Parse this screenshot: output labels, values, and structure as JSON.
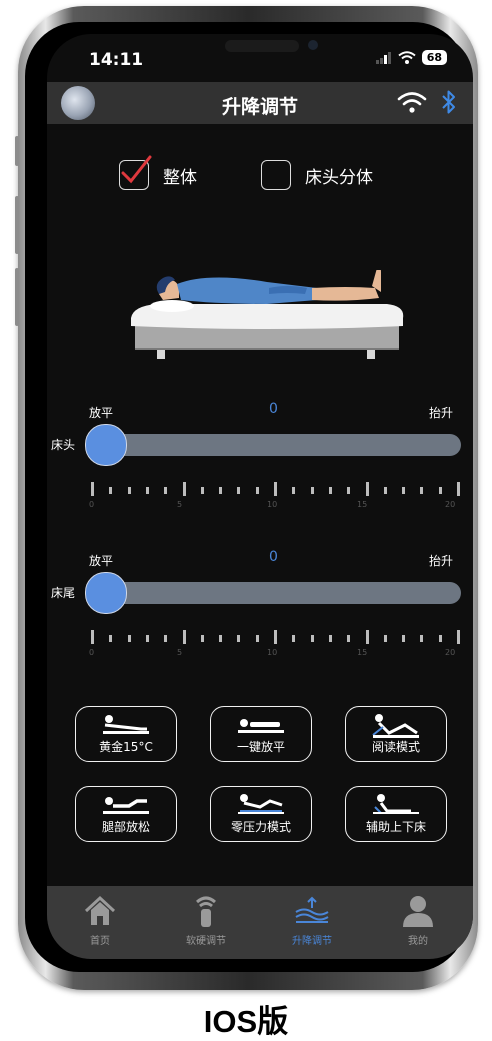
{
  "status_bar": {
    "time": "14:11",
    "battery": "68"
  },
  "header": {
    "title": "升降调节"
  },
  "mode": {
    "whole_label": "整体",
    "split_label": "床头分体",
    "whole_checked": true,
    "split_checked": false
  },
  "head_slider": {
    "left_label": "放平",
    "right_label": "抬升",
    "side_label": "床头",
    "value": "0",
    "tick_labels": [
      "0",
      "5",
      "10",
      "15",
      "20"
    ]
  },
  "foot_slider": {
    "left_label": "放平",
    "right_label": "抬升",
    "side_label": "床尾",
    "value": "0",
    "tick_labels": [
      "0",
      "5",
      "10",
      "15",
      "20"
    ]
  },
  "functions": [
    {
      "label": "黄金15°C",
      "icon": "golden-angle-icon"
    },
    {
      "label": "一键放平",
      "icon": "flat-icon"
    },
    {
      "label": "阅读模式",
      "icon": "reading-icon"
    },
    {
      "label": "腿部放松",
      "icon": "leg-relax-icon"
    },
    {
      "label": "零压力模式",
      "icon": "zero-gravity-icon"
    },
    {
      "label": "辅助上下床",
      "icon": "assist-icon"
    }
  ],
  "tabs": [
    {
      "label": "首页",
      "icon": "home-icon",
      "active": false
    },
    {
      "label": "软硬调节",
      "icon": "firmness-icon",
      "active": false
    },
    {
      "label": "升降调节",
      "icon": "lift-icon",
      "active": true
    },
    {
      "label": "我的",
      "icon": "profile-icon",
      "active": false
    }
  ],
  "caption": "IOS版",
  "colors": {
    "accent": "#4a86d8",
    "check": "#e0393e",
    "track": "#6d7682",
    "thumb": "#5a8fe0"
  }
}
